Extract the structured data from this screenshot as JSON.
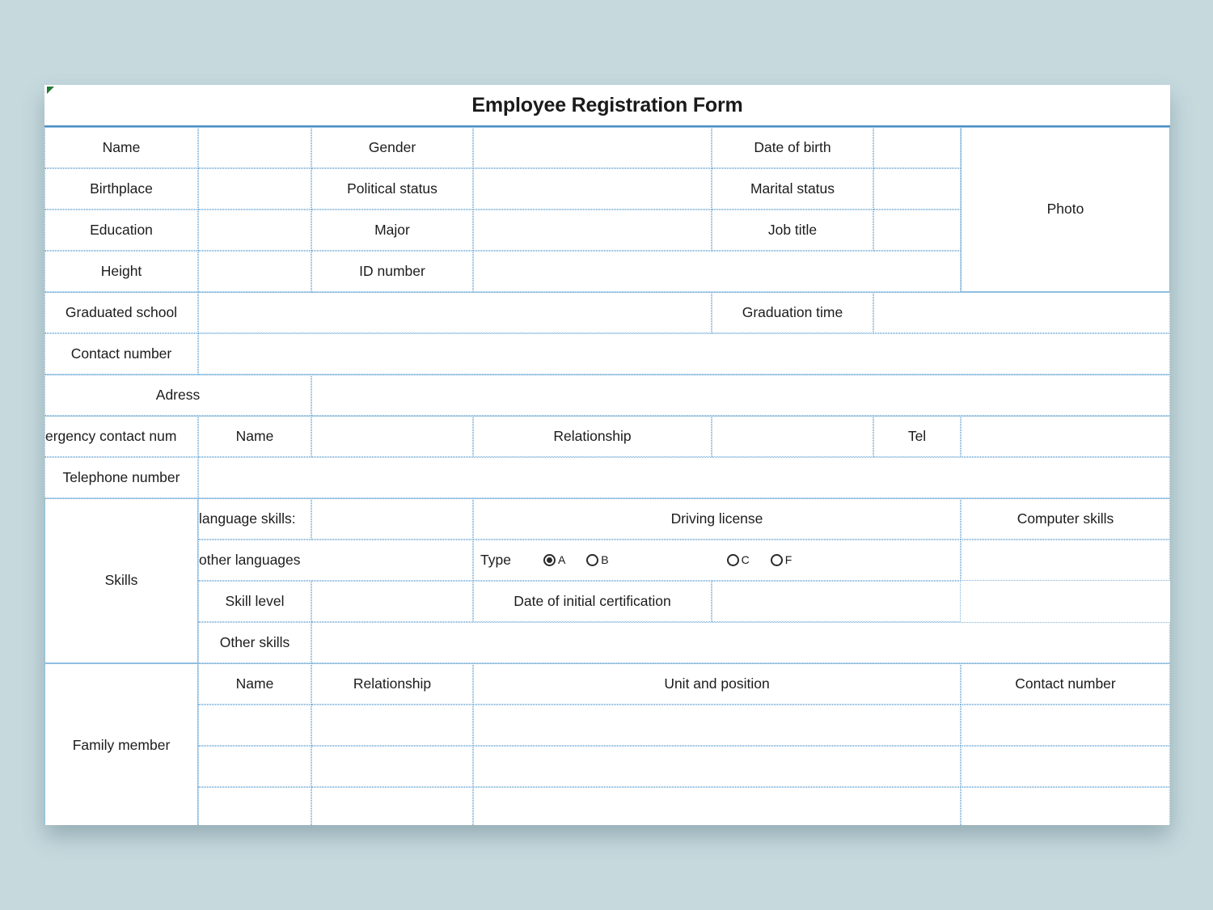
{
  "document": {
    "title": "Employee Registration Form",
    "comment_indicator": "green-triangle"
  },
  "colors": {
    "background": "#c6dade",
    "sheet": "#ffffff",
    "gridline": "#7fb2da",
    "gridline_solid": "#8fbfe0",
    "title_rule": "#4a90c4",
    "text": "#1c1c1c",
    "comment_flag": "#1e7a34"
  },
  "form": {
    "personal": {
      "name_label": "Name",
      "name_value": "",
      "gender_label": "Gender",
      "gender_value": "",
      "dob_label": "Date of birth",
      "dob_value": "",
      "birthplace_label": "Birthplace",
      "birthplace_value": "",
      "political_status_label": "Political status",
      "political_status_value": "",
      "marital_status_label": "Marital status",
      "marital_status_value": "",
      "education_label": "Education",
      "education_value": "",
      "major_label": "Major",
      "major_value": "",
      "job_title_label": "Job title",
      "job_title_value": "",
      "height_label": "Height",
      "height_value": "",
      "id_number_label": "ID number",
      "id_number_value": "",
      "photo_label": "Photo"
    },
    "education": {
      "graduated_school_label": "Graduated school",
      "graduated_school_value": "",
      "graduation_time_label": "Graduation time",
      "graduation_time_value": ""
    },
    "contact": {
      "contact_number_label": "Contact number",
      "contact_number_value": "",
      "address_label": "Adress",
      "address_value": "",
      "telephone_number_label": "Telephone number",
      "telephone_number_value": ""
    },
    "emergency": {
      "section_label": "ergency contact num",
      "section_label_full": "Emergency contact number",
      "name_label": "Name",
      "name_value": "",
      "relationship_label": "Relationship",
      "relationship_value": "",
      "tel_label": "Tel",
      "tel_value": ""
    },
    "skills": {
      "section_label": "Skills",
      "language_skills_label": "language skills:",
      "language_skills_value": "",
      "other_languages_label": "other languages",
      "other_languages_value": "",
      "skill_level_label": "Skill level",
      "skill_level_value": "",
      "other_skills_label": "Other skills",
      "other_skills_value": "",
      "driving_license_label": "Driving license",
      "type_label": "Type",
      "license_types": [
        {
          "code": "A",
          "checked": true
        },
        {
          "code": "B",
          "checked": false
        },
        {
          "code": "C",
          "checked": false
        },
        {
          "code": "F",
          "checked": false
        }
      ],
      "date_of_initial_certification_label": "Date of initial certification",
      "date_of_initial_certification_value": "",
      "computer_skills_label": "Computer skills",
      "computer_skills_value": ""
    },
    "family": {
      "section_label": "Family member",
      "headers": [
        "Name",
        "Relationship",
        "Unit and position",
        "Contact number"
      ],
      "rows": [
        {
          "name": "",
          "relationship": "",
          "unit_and_position": "",
          "contact_number": ""
        },
        {
          "name": "",
          "relationship": "",
          "unit_and_position": "",
          "contact_number": ""
        },
        {
          "name": "",
          "relationship": "",
          "unit_and_position": "",
          "contact_number": ""
        }
      ]
    }
  }
}
